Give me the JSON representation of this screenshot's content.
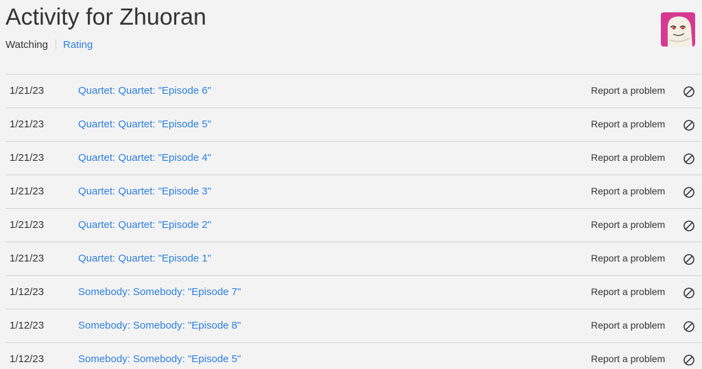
{
  "header": {
    "title": "Activity for Zhuoran",
    "tabs": [
      {
        "label": "Watching",
        "active": true
      },
      {
        "label": "Rating",
        "active": false
      }
    ]
  },
  "avatar": {
    "icon": "profile-avatar-icon",
    "color": "#d6398f"
  },
  "activity": {
    "report_label": "Report a problem",
    "hide_icon": "circle-slash-icon",
    "rows": [
      {
        "date": "1/21/23",
        "title": "Quartet: Quartet: \"Episode 6\""
      },
      {
        "date": "1/21/23",
        "title": "Quartet: Quartet: \"Episode 5\""
      },
      {
        "date": "1/21/23",
        "title": "Quartet: Quartet: \"Episode 4\""
      },
      {
        "date": "1/21/23",
        "title": "Quartet: Quartet: \"Episode 3\""
      },
      {
        "date": "1/21/23",
        "title": "Quartet: Quartet: \"Episode 2\""
      },
      {
        "date": "1/21/23",
        "title": "Quartet: Quartet: \"Episode 1\""
      },
      {
        "date": "1/12/23",
        "title": "Somebody: Somebody: \"Episode 7\""
      },
      {
        "date": "1/12/23",
        "title": "Somebody: Somebody: \"Episode 8\""
      },
      {
        "date": "1/12/23",
        "title": "Somebody: Somebody: \"Episode 5\""
      }
    ]
  },
  "colors": {
    "link": "#2d7fe0",
    "background": "#f3f3f3",
    "divider": "#d2d2d2"
  }
}
